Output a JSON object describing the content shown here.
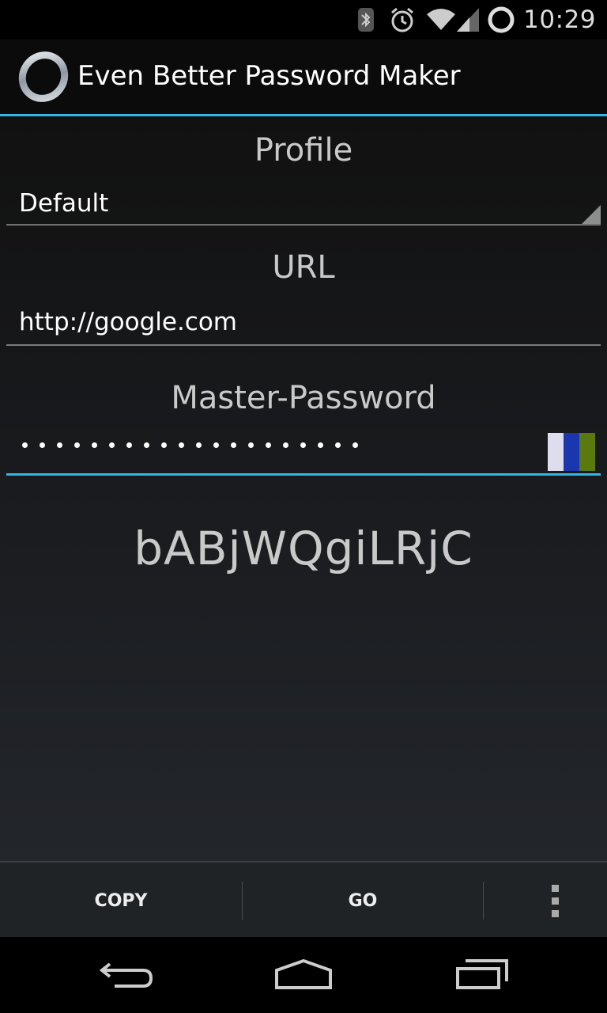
{
  "status_bar": {
    "time": "10:29",
    "icons": [
      "bluetooth-icon",
      "alarm-icon",
      "wifi-icon",
      "signal-icon",
      "sync-icon"
    ]
  },
  "action_bar": {
    "app_icon": "ring-icon",
    "title": "Even Better Password Maker"
  },
  "form": {
    "profile_label": "Profile",
    "profile_value": "Default",
    "url_label": "URL",
    "url_value": "http://google.com",
    "master_label": "Master-Password",
    "master_masked_length": 20,
    "password_color_chip": [
      "#ddddee",
      "#1a37b0",
      "#5a7a10"
    ]
  },
  "generated_password": "bABjWQgiLRjC",
  "bottom_bar": {
    "copy_label": "COPY",
    "go_label": "GO",
    "overflow_icon": "overflow-menu-icon"
  },
  "nav_bar": {
    "icons": [
      "back-icon",
      "home-icon",
      "recents-icon"
    ]
  },
  "colors": {
    "accent": "#33b5e5",
    "background": "#000000"
  }
}
